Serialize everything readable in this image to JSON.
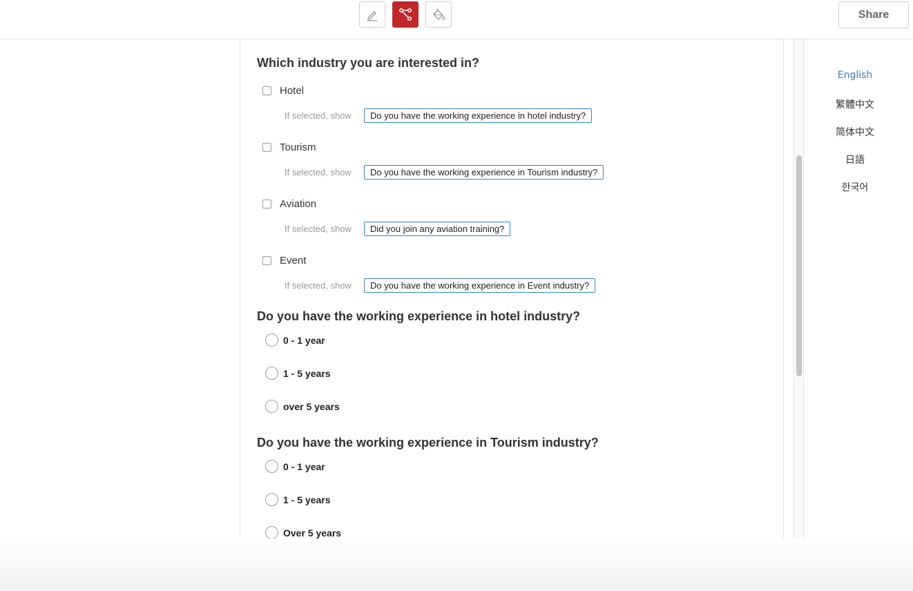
{
  "toolbar": {
    "tools": [
      {
        "icon": "pencil-icon",
        "active": false
      },
      {
        "icon": "logic-branch-icon",
        "active": true
      },
      {
        "icon": "paint-bucket-icon",
        "active": false
      }
    ],
    "share_label": "Share",
    "accent_color": "#c0282d"
  },
  "languages": {
    "items": [
      "English",
      "繁體中文",
      "简体中文",
      "日語",
      "한국어"
    ],
    "selected": "English",
    "selected_color": "#3b7bd4"
  },
  "form": {
    "q1": {
      "title": "Which industry you are interested in?",
      "condition_prefix": "If selected, show",
      "options": [
        {
          "label": "Hotel",
          "shows": "Do you have the working experience in hotel industry?"
        },
        {
          "label": "Tourism",
          "shows": "Do you have the working experience in Tourism industry?"
        },
        {
          "label": "Aviation",
          "shows": "Did you join any aviation training?"
        },
        {
          "label": "Event",
          "shows": "Do you have the working experience in Event industry?"
        }
      ]
    },
    "q2": {
      "title": "Do you have the working experience in hotel industry?",
      "options": [
        "0 - 1 year",
        "1 - 5 years",
        "over 5 years"
      ]
    },
    "q3": {
      "title": "Do you have the working experience in Tourism industry?",
      "options": [
        "0 - 1 year",
        "1 - 5 years",
        "Over 5 years"
      ]
    }
  }
}
